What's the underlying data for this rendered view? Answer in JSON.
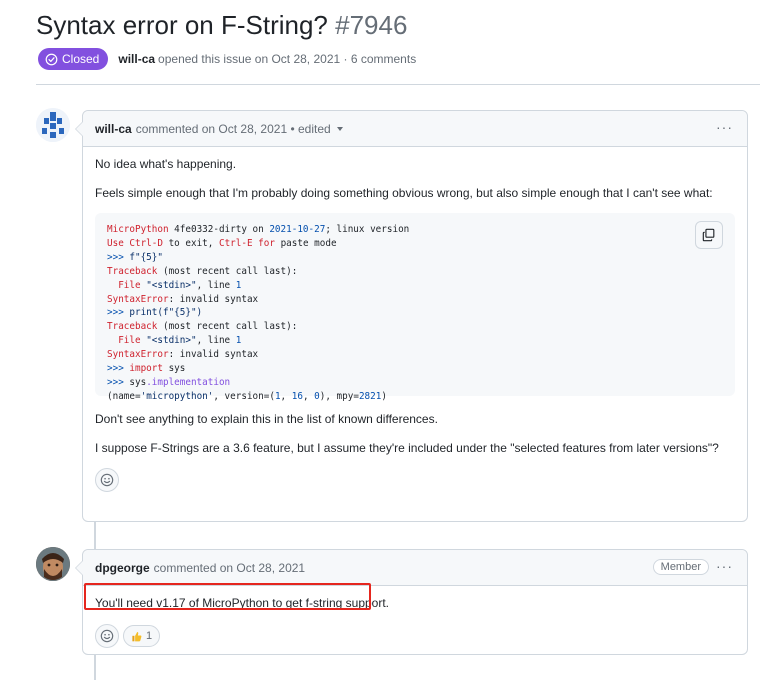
{
  "issue": {
    "title": "Syntax error on F-String?",
    "number": "#7946",
    "state": "Closed",
    "author": "will-ca",
    "opened_text": "opened this issue on Oct 28, 2021 · 6 comments"
  },
  "comments": [
    {
      "author": "will-ca",
      "action": "commented on Oct 28, 2021 • edited",
      "paragraphs": [
        "No idea what's happening.",
        "Feels simple enough that I'm probably doing something obvious wrong, but also simple enough that I can't see what:"
      ],
      "after_paragraphs": [
        "Don't see anything to explain this in the list of known differences.",
        "I suppose F-Strings are a 3.6 feature, but I assume they're included under the \"selected features from later versions\"?"
      ]
    },
    {
      "author": "dpgeorge",
      "action": "commented on Oct 28, 2021",
      "badge": "Member",
      "text": "You'll need v1.17 of MicroPython to get f-string support.",
      "reaction_count": "1"
    }
  ],
  "code_lines": [
    "MicroPython 4fe0332-dirty on 2021-10-27; linux version",
    "Use Ctrl-D to exit, Ctrl-E for paste mode",
    ">>> f\"{5}\"",
    "Traceback (most recent call last):",
    "  File \"<stdin>\", line 1",
    "SyntaxError: invalid syntax",
    ">>> print(f\"{5}\")",
    "Traceback (most recent call last):",
    "  File \"<stdin>\", line 1",
    "SyntaxError: invalid syntax",
    ">>> import sys",
    ">>> sys.implementation",
    "(name='micropython', version=(1, 16, 0), mpy=2821)"
  ],
  "icons": {
    "state": "issue-closed-icon",
    "copy": "copy-icon",
    "kebab": "kebab-horizontal-icon",
    "smiley": "smiley-icon",
    "thumbsup": "thumbsup-icon"
  },
  "colors": {
    "closed_badge": "#8250df",
    "highlight": "#e5261e",
    "border": "#d0d7de"
  }
}
